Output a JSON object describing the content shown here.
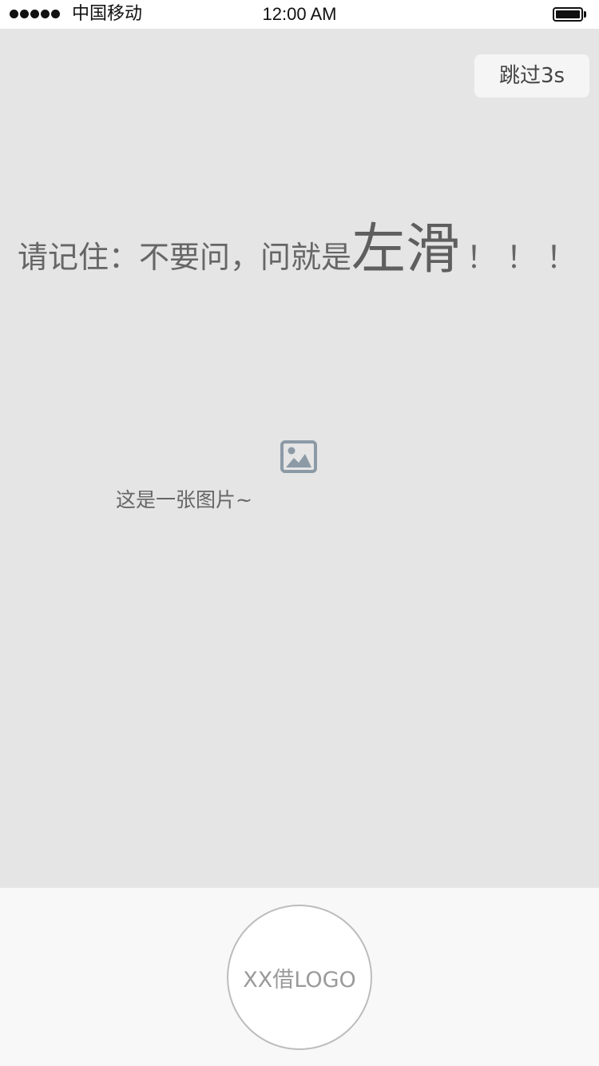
{
  "status_bar": {
    "carrier": "中国移动",
    "time": "12:00 AM",
    "signal_bars": 5,
    "battery_level": 1.0
  },
  "skip": {
    "label": "跳过3s"
  },
  "slogan": {
    "prefix": "请记住：不要问，问就是",
    "emphasis": "左滑",
    "suffix": "！！！"
  },
  "image_placeholder": {
    "icon": "image-icon",
    "caption": "这是一张图片~"
  },
  "footer": {
    "logo_text": "XX借LOGO"
  },
  "colors": {
    "background": "#e5e5e5",
    "footer_background": "#f8f8f8",
    "text": "#666666",
    "icon": "#8c9aa6"
  }
}
